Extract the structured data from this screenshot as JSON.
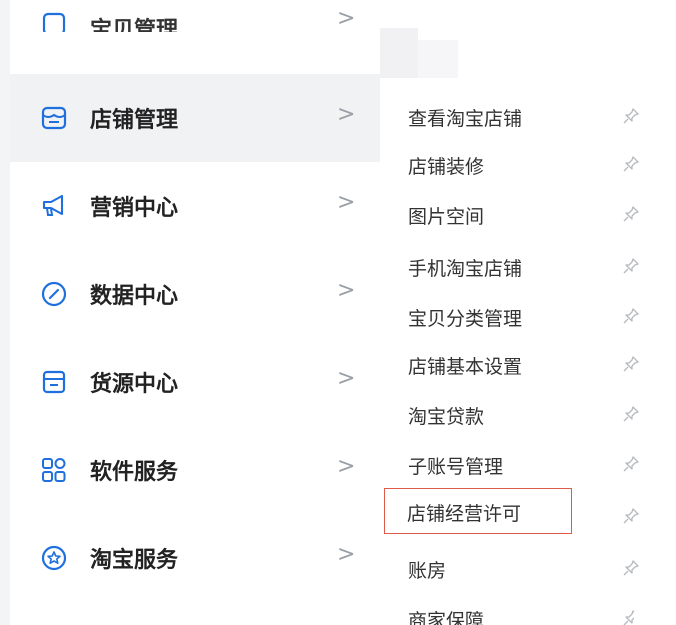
{
  "main_menu": [
    {
      "key": "baobei",
      "label": "宝贝管理",
      "chevron": ">",
      "icon": "goods-icon"
    },
    {
      "key": "dianpu",
      "label": "店铺管理",
      "chevron": ">",
      "icon": "store-icon"
    },
    {
      "key": "yingxiao",
      "label": "营销中心",
      "chevron": ">",
      "icon": "megaphone-icon"
    },
    {
      "key": "shuju",
      "label": "数据中心",
      "chevron": ">",
      "icon": "compass-icon"
    },
    {
      "key": "huoyuan",
      "label": "货源中心",
      "chevron": ">",
      "icon": "box-icon"
    },
    {
      "key": "ruanjian",
      "label": "软件服务",
      "chevron": ">",
      "icon": "apps-grid-icon"
    },
    {
      "key": "taobao",
      "label": "淘宝服务",
      "chevron": ">",
      "icon": "star-badge-icon"
    }
  ],
  "submenu": [
    {
      "label": "查看淘宝店铺"
    },
    {
      "label": "店铺装修"
    },
    {
      "label": "图片空间"
    },
    {
      "label": "手机淘宝店铺"
    },
    {
      "label": "宝贝分类管理"
    },
    {
      "label": "店铺基本设置"
    },
    {
      "label": "淘宝贷款"
    },
    {
      "label": "子账号管理"
    },
    {
      "label": "店铺经营许可"
    },
    {
      "label": "账房"
    },
    {
      "label": "商家保障"
    }
  ],
  "colors": {
    "accent": "#1f6fde",
    "highlight_border": "#e05a4a",
    "text": "#222222"
  }
}
